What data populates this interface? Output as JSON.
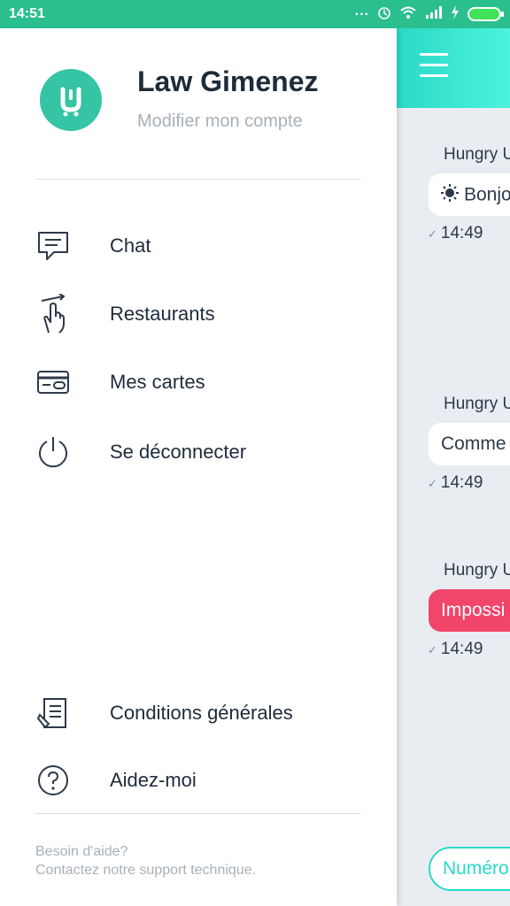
{
  "status_bar": {
    "time": "14:51",
    "dots": "...",
    "colors": {
      "background": "#2bbf8f"
    }
  },
  "drawer": {
    "user_name": "Law Gimenez",
    "account_link": "Modifier mon compte",
    "menu": [
      {
        "label": "Chat",
        "icon": "chat-bubble-icon"
      },
      {
        "label": "Restaurants",
        "icon": "hand-pointer-icon"
      },
      {
        "label": "Mes cartes",
        "icon": "credit-card-icon"
      },
      {
        "label": "Se déconnecter",
        "icon": "power-icon"
      }
    ],
    "bottom_menu": [
      {
        "label": "Conditions générales",
        "icon": "document-icon"
      },
      {
        "label": "Aidez-moi",
        "icon": "question-circle-icon"
      }
    ],
    "help_line1": "Besoin d'aide?",
    "help_line2": "Contactez notre support technique."
  },
  "chat": {
    "messages": [
      {
        "author": "Hungry U",
        "text": "Bonjo",
        "time": "14:49",
        "status": "normal",
        "icon": "sun-icon"
      },
      {
        "author": "Hungry U",
        "text": "Comme",
        "time": "14:49",
        "status": "normal"
      },
      {
        "author": "Hungry U",
        "text": "Impossi",
        "time": "14:49",
        "status": "error"
      }
    ],
    "input_pill": "Numéro",
    "colors": {
      "header": "#2ad9c7",
      "error_bubble": "#f2456a",
      "accent": "#35c4a4"
    }
  }
}
